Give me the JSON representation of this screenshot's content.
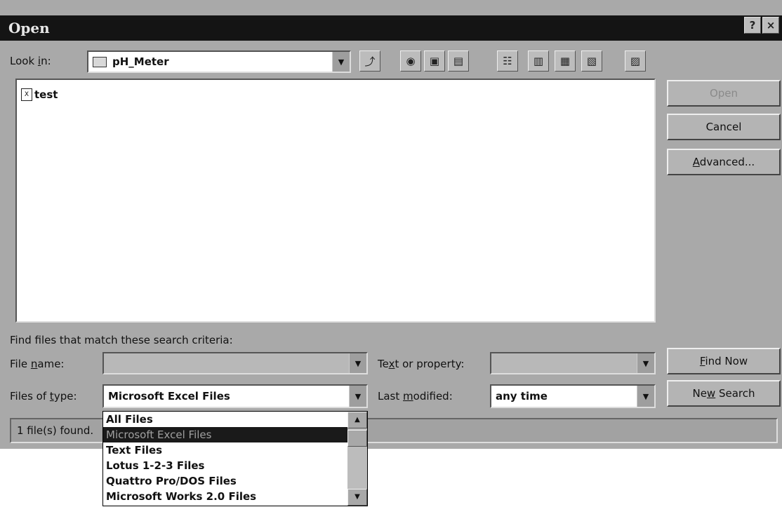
{
  "window": {
    "title": "Open",
    "help_icon": "?",
    "close_icon": "×"
  },
  "lookin": {
    "label": "Look in:",
    "value": "pH_Meter"
  },
  "files": [
    {
      "name": "test",
      "icon": "excel-file-icon"
    }
  ],
  "buttons": {
    "open": "Open",
    "cancel": "Cancel",
    "advanced": "Advanced...",
    "find_now": "Find Now",
    "new_search": "New Search"
  },
  "criteria": {
    "heading": "Find files that match these search criteria:",
    "file_name_label": "File name:",
    "file_name_value": "",
    "files_of_type_label": "Files of type:",
    "files_of_type_value": "Microsoft Excel Files",
    "text_property_label": "Text or property:",
    "text_property_value": "",
    "last_modified_label": "Last modified:",
    "last_modified_value": "any time"
  },
  "status": "1 file(s) found.",
  "type_options": [
    "All Files",
    "Microsoft Excel Files",
    "Text Files",
    "Lotus 1-2-3 Files",
    "Quattro Pro/DOS Files",
    "Microsoft Works 2.0 Files"
  ],
  "selected_type_index": 1,
  "toolbar_icons": [
    "up-one-level-icon",
    "search-web-icon",
    "add-to-favorites-icon",
    "look-in-favorites-icon",
    "list-view-icon",
    "details-view-icon",
    "properties-view-icon",
    "preview-view-icon",
    "commands-settings-icon"
  ]
}
